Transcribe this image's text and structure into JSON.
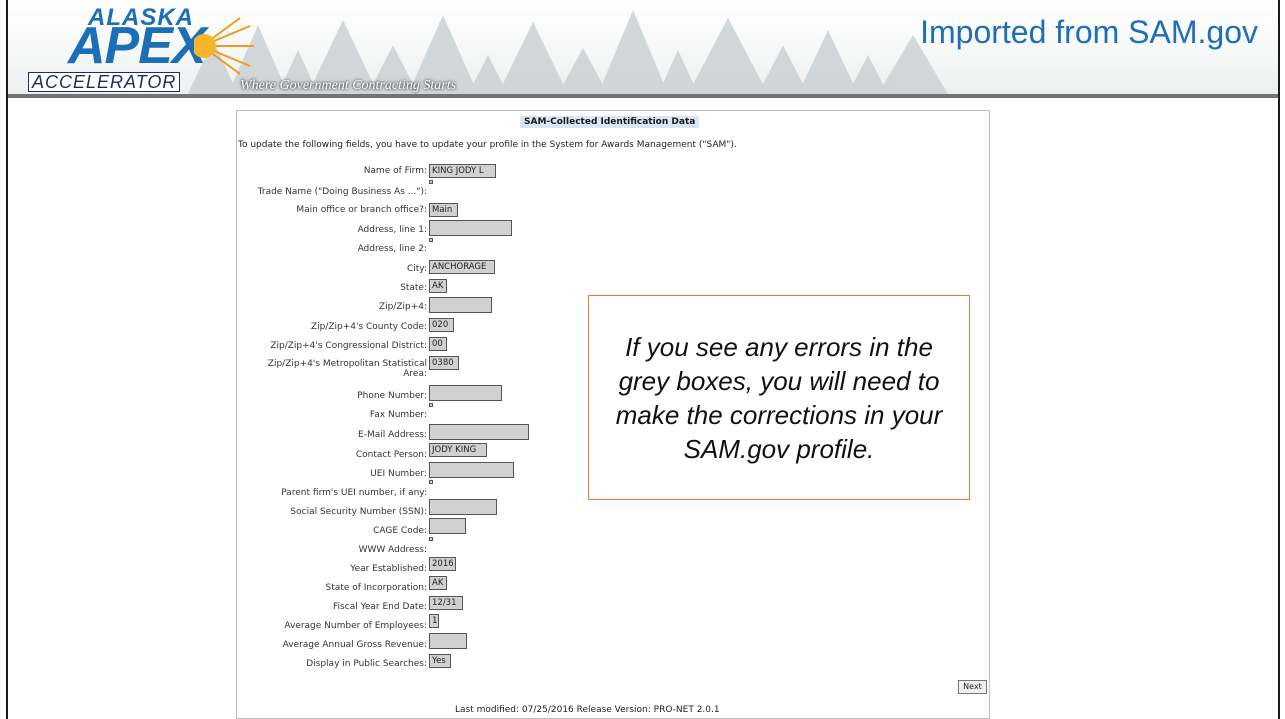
{
  "header": {
    "logo": {
      "line1": "ALASKA",
      "line2": "APEX",
      "line3": "ACCELERATOR"
    },
    "tagline": "Where Government Contracting Starts",
    "title": "Imported from SAM.gov"
  },
  "form": {
    "section_title": "SAM-Collected Identification Data",
    "intro": "To update the following fields, you have to update your profile in the System for Awards Management (\"SAM\").",
    "fields": [
      {
        "label": "Name of Firm:",
        "value": "KING JODY L"
      },
      {
        "label": "Trade Name (\"Doing Business As ...\"):",
        "value": ""
      },
      {
        "label": "Main office or branch office?:",
        "value": "Main"
      },
      {
        "label": "Address, line 1:",
        "value": ""
      },
      {
        "label": "Address, line 2:",
        "value": ""
      },
      {
        "label": "City:",
        "value": "ANCHORAGE"
      },
      {
        "label": "State:",
        "value": "AK"
      },
      {
        "label": "Zip/Zip+4:",
        "value": ""
      },
      {
        "label": "Zip/Zip+4's County Code:",
        "value": "020"
      },
      {
        "label": "Zip/Zip+4's Congressional District:",
        "value": "00"
      },
      {
        "label": "Zip/Zip+4's Metropolitan Statistical",
        "label2": "Area:",
        "value": "0380"
      },
      {
        "label": "Phone Number:",
        "value": ""
      },
      {
        "label": "Fax Number:",
        "value": ""
      },
      {
        "label": "E-Mail Address:",
        "value": ""
      },
      {
        "label": "Contact Person:",
        "value": "JODY KING"
      },
      {
        "label": "UEI Number:",
        "value": ""
      },
      {
        "label": "Parent firm's UEI number, if any:",
        "value": ""
      },
      {
        "label": "Social Security Number (SSN):",
        "value": ""
      },
      {
        "label": "CAGE Code:",
        "value": ""
      },
      {
        "label": "WWW Address:",
        "value": ""
      },
      {
        "label": "Year Established:",
        "value": "2016"
      },
      {
        "label": "State of Incorporation:",
        "value": "AK"
      },
      {
        "label": "Fiscal Year End Date:",
        "value": "12/31"
      },
      {
        "label": "Average Number of Employees:",
        "value": "1"
      },
      {
        "label": "Average Annual Gross Revenue:",
        "value": ""
      },
      {
        "label": "Display in Public Searches:",
        "value": "Yes"
      }
    ],
    "next_label": "Next",
    "footer": "Last modified: 07/25/2016 Release Version: PRO-NET 2.0.1"
  },
  "callout": {
    "text": "If you see any errors in the grey boxes, you will need to make the corrections in your SAM.gov profile."
  },
  "colors": {
    "title_blue": "#1f6fb8",
    "field_grey": "#d1d1d1",
    "callout_border": "#e07a3d"
  }
}
